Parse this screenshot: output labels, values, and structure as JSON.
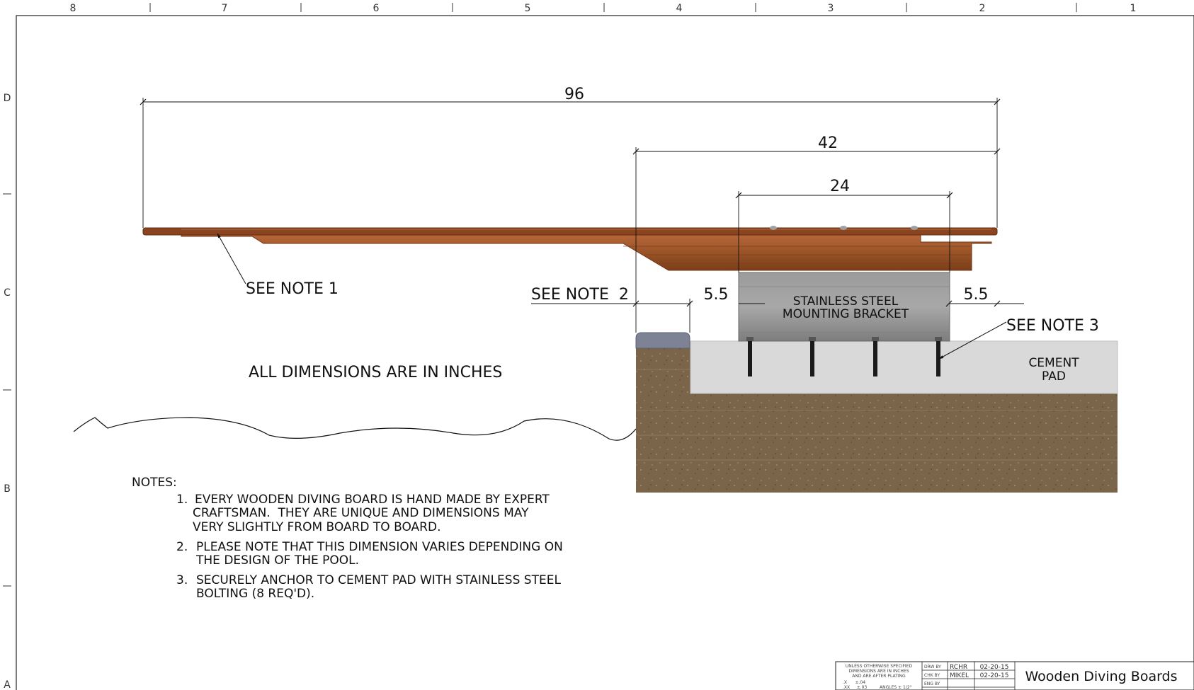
{
  "sheet": {
    "zone_columns": [
      "8",
      "7",
      "6",
      "5",
      "4",
      "3",
      "2",
      "1"
    ],
    "zone_rows": [
      "D",
      "C",
      "B",
      "A"
    ]
  },
  "dimensions": {
    "overall": "96",
    "mid": "42",
    "bracket": "24",
    "left_gap": "5.5",
    "right_gap": "5.5"
  },
  "callouts": {
    "note1": "SEE NOTE 1",
    "note2": "SEE NOTE  2",
    "note3": "SEE NOTE 3",
    "bracket_line1": "STAINLESS STEEL",
    "bracket_line2": "MOUNTING BRACKET",
    "pad_line1": "CEMENT",
    "pad_line2": "PAD",
    "units": "ALL DIMENSIONS ARE IN INCHES"
  },
  "notes": {
    "heading": "NOTES:",
    "items": [
      {
        "num": "1.",
        "lines": [
          "EVERY WOODEN DIVING BOARD IS HAND MADE BY EXPERT",
          "CRAFTSMAN.  THEY ARE UNIQUE AND DIMENSIONS MAY",
          "VERY SLIGHTLY FROM BOARD TO BOARD."
        ]
      },
      {
        "num": "2.",
        "lines": [
          "PLEASE NOTE THAT THIS DIMENSION VARIES DEPENDING ON",
          "THE DESIGN OF THE POOL."
        ]
      },
      {
        "num": "3.",
        "lines": [
          "SECURELY ANCHOR TO CEMENT PAD WITH STAINLESS STEEL",
          "BOLTING (8 REQ'D)."
        ]
      }
    ]
  },
  "title_block": {
    "spec_line1": "UNLESS OTHERWISE SPECIFIED",
    "spec_line2": "DIMENSIONS ARE IN INCHES",
    "spec_line3": "AND ARE AFTER PLATING",
    "tol_x": ".X      ±.04",
    "tol_xx": ".XX     ±.03",
    "tol_ang": "ANGLES ± 1/2°",
    "drw_label": "DRW BY",
    "drw_name": "RCHR",
    "drw_date": "02-20-15",
    "chk_label": "CHK BY",
    "chk_name": "MIKEL",
    "chk_date": "02-20-15",
    "eng_label": "ENG BY",
    "title": "Wooden Diving Boards"
  },
  "colors": {
    "wood": "#9a5428",
    "wood_dark": "#6e3514",
    "steel": "#8e8e8e",
    "concrete": "#d9d9d9",
    "soil": "#7a644a"
  }
}
